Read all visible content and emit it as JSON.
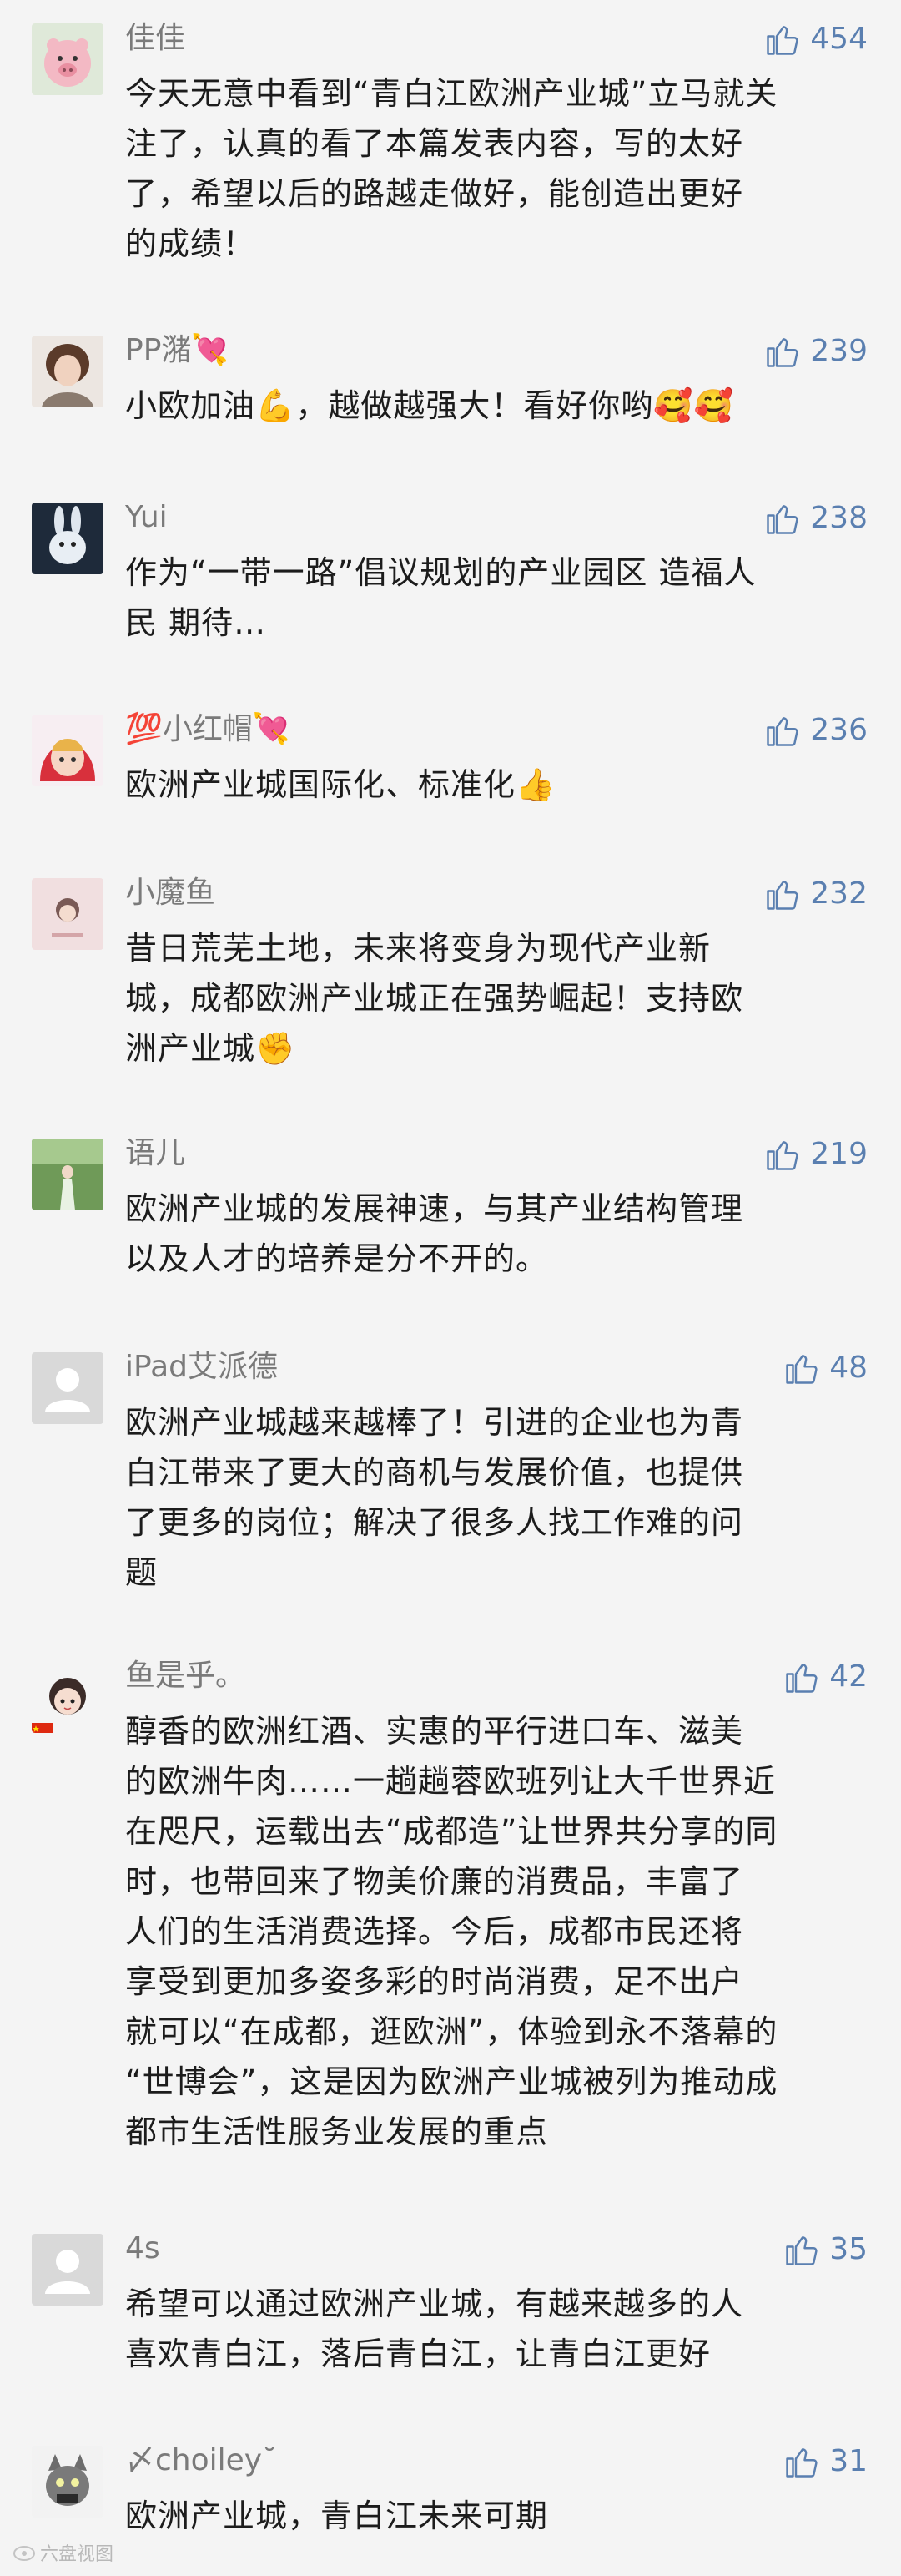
{
  "comments": [
    {
      "user": "佳佳",
      "likes": "454",
      "text": "今天无意中看到“青白江欧洲产业城”立马就关\n注了，认真的看了本篇发表内容，写的太好\n了，希望以后的路越走做好，能创造出更好\n的成绩！",
      "avatar": "pig-avatar"
    },
    {
      "user": "PP潴💘",
      "likes": "239",
      "text": "小欧加油💪，越做越强大！看好你哟🥰🥰",
      "avatar": "woman-avatar"
    },
    {
      "user": "Yui",
      "likes": "238",
      "text": "作为“一带一路”倡议规划的产业园区 造福人\n民 期待…",
      "avatar": "bunny-avatar"
    },
    {
      "user": "💯小红帽💘",
      "likes": "236",
      "text": "欧洲产业城国际化、标准化👍",
      "avatar": "red-hood-avatar"
    },
    {
      "user": "小魔鱼",
      "likes": "232",
      "text": "昔日荒芜土地，未来将变身为现代产业新\n城，成都欧洲产业城正在强势崛起！支持欧\n洲产业城✊",
      "avatar": "girl-pink-avatar"
    },
    {
      "user": "语儿",
      "likes": "219",
      "text": "欧洲产业城的发展神速，与其产业结构管理\n以及人才的培养是分不开的。",
      "avatar": "green-field-avatar"
    },
    {
      "user": "iPad艾派德",
      "likes": "48",
      "text": "欧洲产业城越来越棒了！引进的企业也为青\n白江带来了更大的商机与发展价值，也提供\n了更多的岗位；解决了很多人找工作难的问\n题",
      "avatar": "default-avatar"
    },
    {
      "user": "鱼是乎。",
      "likes": "42",
      "text": "醇香的欧洲红酒、实惠的平行进口车、滋美\n的欧洲牛肉……一趟趟蓉欧班列让大千世界近\n在咫尺，运载出去“成都造”让世界共分享的同\n时，也带回来了物美价廉的消费品，丰富了\n人们的生活消费选择。今后，成都市民还将\n享受到更加多姿多彩的时尚消费，足不出户\n就可以“在成都，逛欧洲”，体验到永不落幕的\n“世博会”，这是因为欧洲产业城被列为推动成\n都市生活性服务业发展的重点",
      "avatar": "cartoon-girl-avatar"
    },
    {
      "user": "4s",
      "likes": "35",
      "text": "希望可以通过欧洲产业城，有越来越多的人\n喜欢青白江，落后青白江，让青白江更好",
      "avatar": "default-avatar"
    },
    {
      "user": "〆choiley˘",
      "likes": "31",
      "text": "欧洲产业城，青白江未来可期",
      "avatar": "cat-avatar"
    }
  ],
  "watermark": "六盘视图",
  "colors": {
    "like": "#5a7fb0",
    "name": "#7a7a7a",
    "text": "#1c1c1c",
    "background": "#f4f4f4"
  }
}
